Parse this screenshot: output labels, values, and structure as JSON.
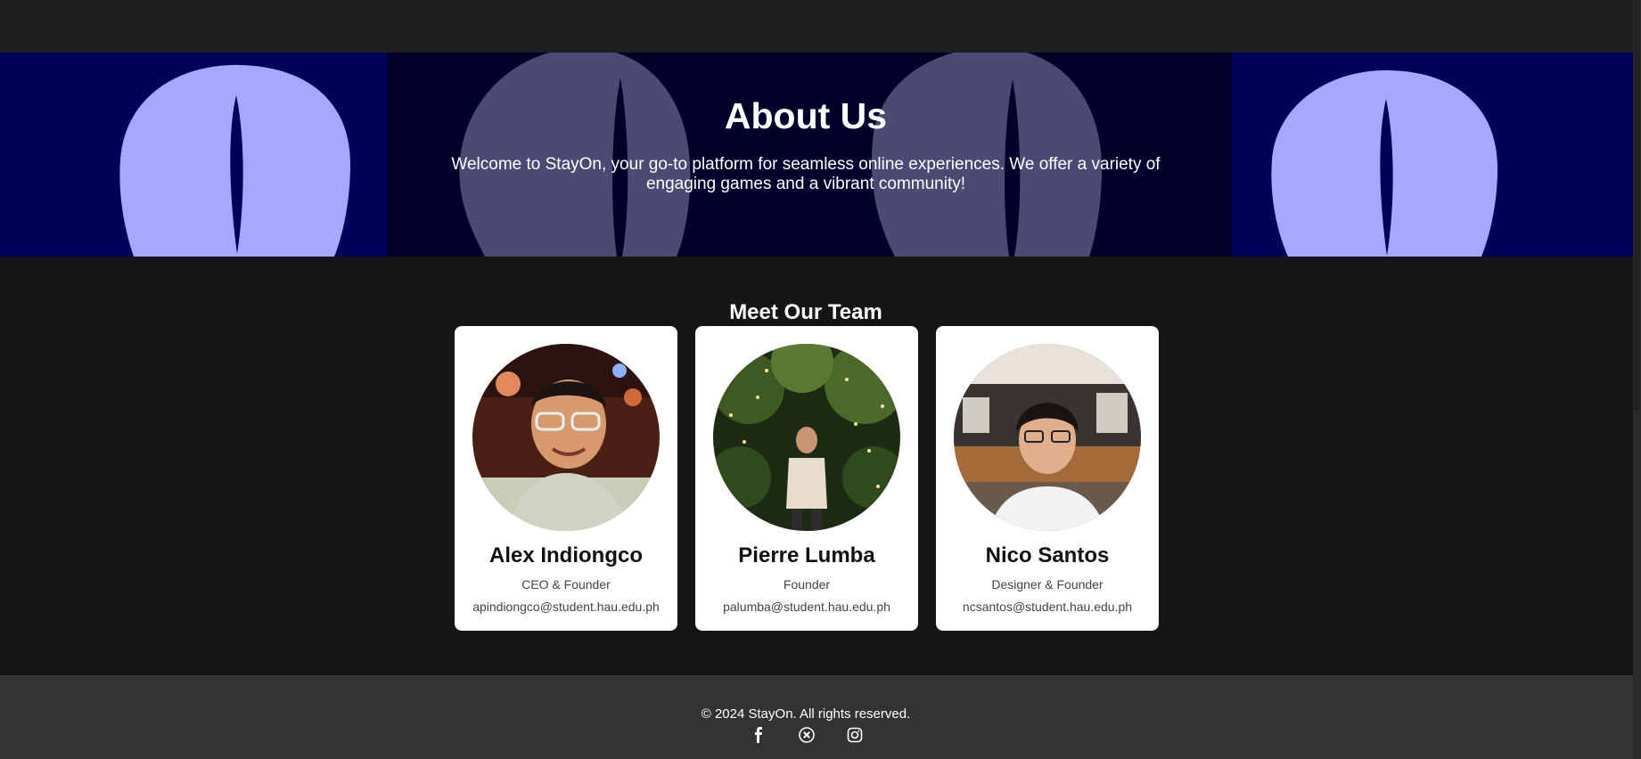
{
  "hero": {
    "title": "About Us",
    "text": "Welcome to StayOn, your go-to platform for seamless online experiences. We offer a variety of engaging games and a vibrant community!"
  },
  "team": {
    "title": "Meet Our Team",
    "members": [
      {
        "name": "Alex Indiongco",
        "role": "CEO & Founder",
        "email": "apindiongco@student.hau.edu.ph"
      },
      {
        "name": "Pierre Lumba",
        "role": "Founder",
        "email": "palumba@student.hau.edu.ph"
      },
      {
        "name": "Nico Santos",
        "role": "Designer & Founder",
        "email": "ncsantos@student.hau.edu.ph"
      }
    ]
  },
  "footer": {
    "copyright": "© 2024 StayOn. All rights reserved.",
    "social": [
      "facebook-icon",
      "x-icon",
      "instagram-icon"
    ]
  },
  "colors": {
    "background": "#151515",
    "hero_blue": "#00005a",
    "eye": "#a7a7ff",
    "card": "#ffffff",
    "footer": "#333333"
  }
}
